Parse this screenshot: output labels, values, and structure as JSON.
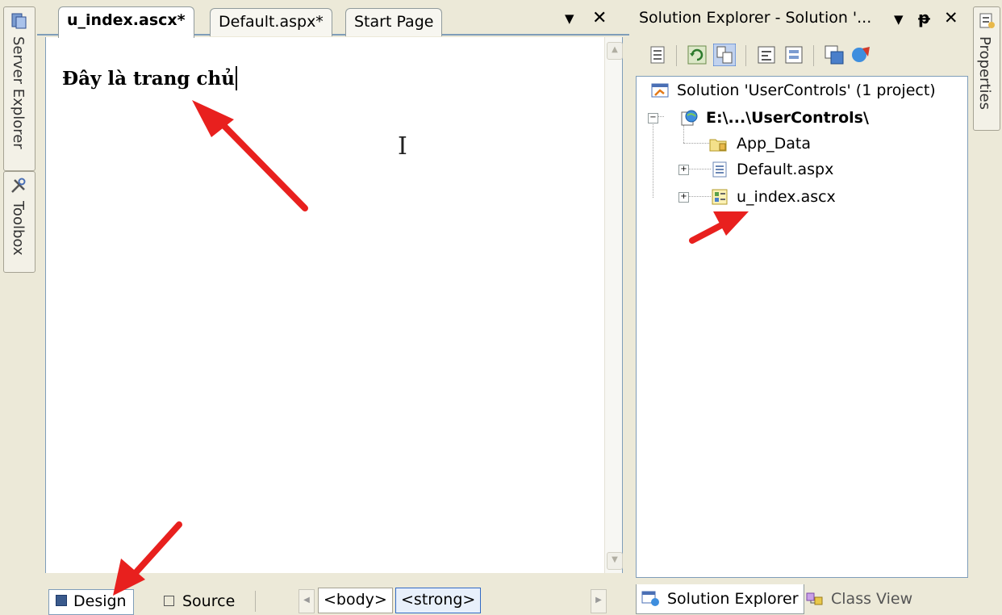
{
  "left_rail": {
    "tabs": [
      {
        "label": "Server Explorer",
        "icon": "server-explorer-icon"
      },
      {
        "label": "Toolbox",
        "icon": "toolbox-icon"
      }
    ]
  },
  "right_rail": {
    "tabs": [
      {
        "label": "Properties",
        "icon": "properties-icon"
      }
    ]
  },
  "editor": {
    "tabs": [
      {
        "label": "u_index.ascx*",
        "active": true
      },
      {
        "label": "Default.aspx*",
        "active": false
      },
      {
        "label": "Start Page",
        "active": false
      }
    ],
    "dropdown_glyph": "▼",
    "close_glyph": "✕",
    "content_text": "Đây là trang chủ",
    "view_buttons": {
      "design": "Design",
      "source": "Source"
    },
    "tag_path": [
      "<body>",
      "<strong>"
    ]
  },
  "solution_explorer": {
    "title": "Solution Explorer - Solution '...",
    "title_glyphs": {
      "dropdown": "▼",
      "pin": "ᵽ",
      "close": "✕"
    },
    "tree": {
      "solution": "Solution 'UserControls' (1 project)",
      "project": "E:\\...\\UserControls\\",
      "items": [
        "App_Data",
        "Default.aspx",
        "u_index.ascx"
      ]
    },
    "bottom_tabs": [
      "Solution Explorer",
      "Class View"
    ]
  },
  "annotation_color": "#E8201E"
}
